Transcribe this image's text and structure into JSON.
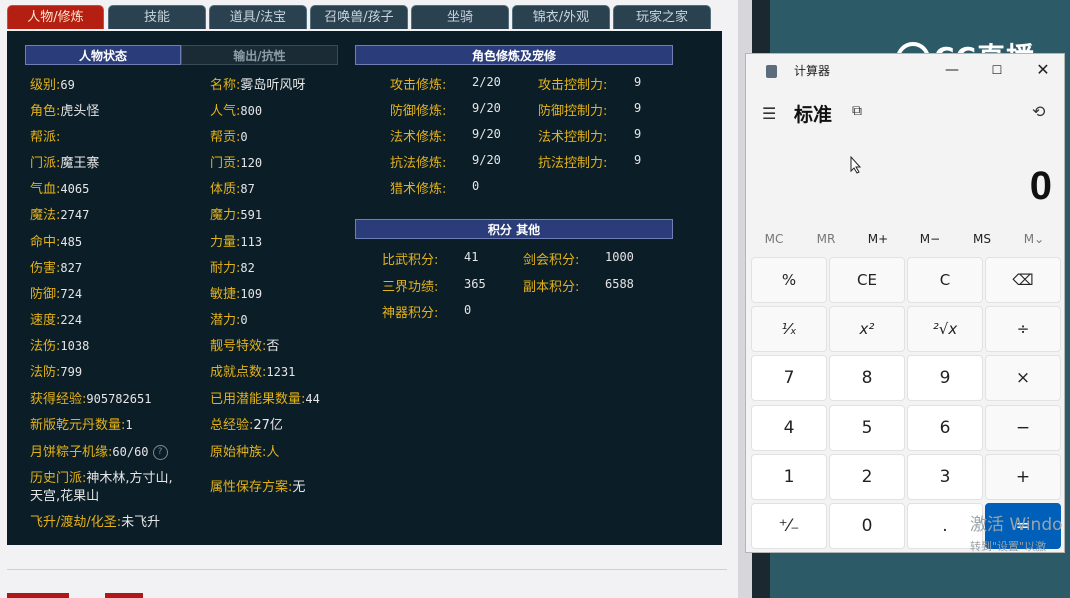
{
  "tabs": [
    {
      "label": "人物/修炼",
      "active": true
    },
    {
      "label": "技能",
      "active": false
    },
    {
      "label": "道具/法宝",
      "active": false
    },
    {
      "label": "召唤兽/孩子",
      "active": false
    },
    {
      "label": "坐骑",
      "active": false
    },
    {
      "label": "锦衣/外观",
      "active": false
    },
    {
      "label": "玩家之家",
      "active": false
    }
  ],
  "status": {
    "header_active": "人物状态",
    "header_inactive": "输出/抗性",
    "left": [
      {
        "label": "级别:",
        "value": "69"
      },
      {
        "label": "角色:",
        "value": "虎头怪"
      },
      {
        "label": "帮派:",
        "value": ""
      },
      {
        "label": "门派:",
        "value": "魔王寨"
      },
      {
        "label": "气血:",
        "value": "4065"
      },
      {
        "label": "魔法:",
        "value": "2747"
      },
      {
        "label": "命中:",
        "value": "485"
      },
      {
        "label": "伤害:",
        "value": "827"
      },
      {
        "label": "防御:",
        "value": "724"
      },
      {
        "label": "速度:",
        "value": "224"
      },
      {
        "label": "法伤:",
        "value": "1038"
      },
      {
        "label": "法防:",
        "value": "799"
      },
      {
        "label": "获得经验:",
        "value": "905782651"
      },
      {
        "label": "新版乾元丹数量:",
        "value": "1"
      },
      {
        "label": "月饼粽子机缘:",
        "value": "60/60"
      }
    ],
    "right": [
      {
        "label": "名称:",
        "value": "雾岛听风呀"
      },
      {
        "label": "人气:",
        "value": "800"
      },
      {
        "label": "帮贡:",
        "value": "0"
      },
      {
        "label": "门贡:",
        "value": "120"
      },
      {
        "label": "体质:",
        "value": "87"
      },
      {
        "label": "魔力:",
        "value": "591"
      },
      {
        "label": "力量:",
        "value": "113"
      },
      {
        "label": "耐力:",
        "value": "82"
      },
      {
        "label": "敏捷:",
        "value": "109"
      },
      {
        "label": "潜力:",
        "value": "0"
      },
      {
        "label": "靓号特效:",
        "value": "否"
      },
      {
        "label": "成就点数:",
        "value": "1231"
      },
      {
        "label": "已用潜能果数量:",
        "value": "44"
      },
      {
        "label": "总经验:",
        "value": "27亿"
      },
      {
        "label": "原始种族:",
        "value": "人"
      }
    ],
    "history_label": "历史门派:",
    "history_value_line1": "神木林,方寸山,",
    "history_value_line2": "天宫,花果山",
    "save_label": "属性保存方案:",
    "save_value": "无",
    "ascend_label": "飞升/渡劫/化圣:",
    "ascend_value": "未飞升"
  },
  "cultivation": {
    "header": "角色修炼及宠修",
    "rows": [
      {
        "l1": "攻击修炼:",
        "v1": "2/20",
        "l2": "攻击控制力:",
        "v2": "9"
      },
      {
        "l1": "防御修炼:",
        "v1": "9/20",
        "l2": "防御控制力:",
        "v2": "9"
      },
      {
        "l1": "法术修炼:",
        "v1": "9/20",
        "l2": "法术控制力:",
        "v2": "9"
      },
      {
        "l1": "抗法修炼:",
        "v1": "9/20",
        "l2": "抗法控制力:",
        "v2": "9"
      },
      {
        "l1": "猎术修炼:",
        "v1": "0",
        "l2": "",
        "v2": ""
      }
    ]
  },
  "score": {
    "header": "积分 其他",
    "rows": [
      {
        "l1": "比武积分:",
        "v1": "41",
        "l2": "剑会积分:",
        "v2": "1000"
      },
      {
        "l1": "三界功绩:",
        "v1": "365",
        "l2": "副本积分:",
        "v2": "6588"
      },
      {
        "l1": "神器积分:",
        "v1": "0",
        "l2": "",
        "v2": ""
      }
    ]
  },
  "overlay": {
    "logo_text": "CC直播"
  },
  "calculator": {
    "title": "计算器",
    "mode": "标准",
    "display": "0",
    "memory": [
      {
        "label": "MC",
        "enabled": false
      },
      {
        "label": "MR",
        "enabled": false
      },
      {
        "label": "M+",
        "enabled": true
      },
      {
        "label": "M−",
        "enabled": true
      },
      {
        "label": "MS",
        "enabled": true
      },
      {
        "label": "M⌄",
        "enabled": false
      }
    ],
    "keys": [
      [
        "%",
        "CE",
        "C",
        "⌫"
      ],
      [
        "¹⁄ₓ",
        "x²",
        "²√x",
        "÷"
      ],
      [
        "7",
        "8",
        "9",
        "×"
      ],
      [
        "4",
        "5",
        "6",
        "−"
      ],
      [
        "1",
        "2",
        "3",
        "+"
      ],
      [
        "⁺⁄₋",
        "0",
        ".",
        "="
      ]
    ],
    "watermark_line1": "激活 Windo",
    "watermark_line2": "转到\"设置\"以激"
  }
}
